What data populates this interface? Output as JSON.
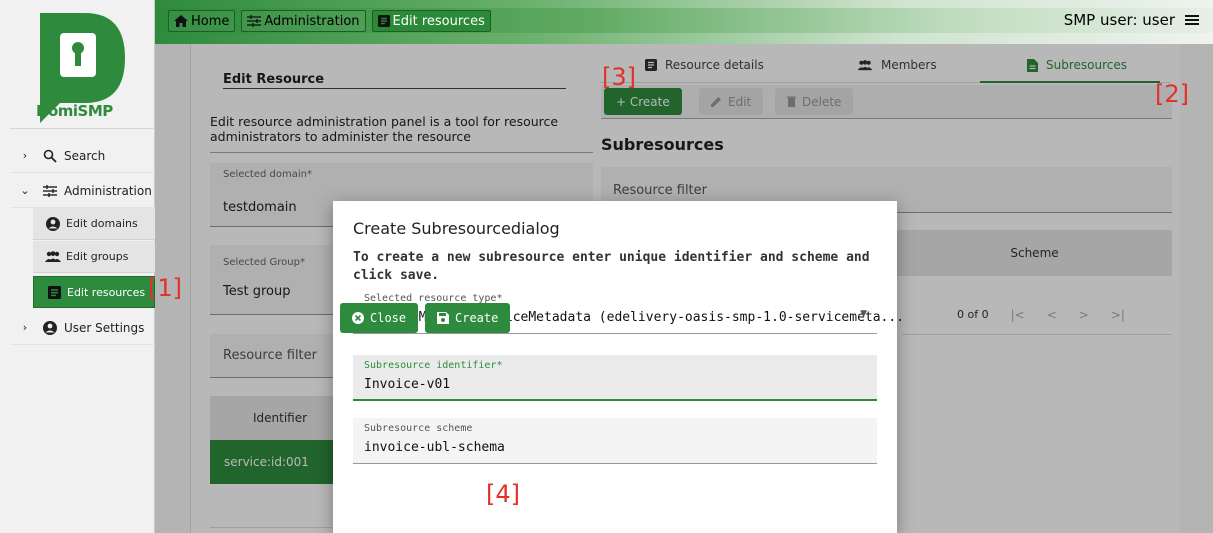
{
  "header": {
    "breadcrumbs": [
      "Home",
      "Administration",
      "Edit resources"
    ],
    "user_label": "SMP user: user"
  },
  "sidebar": {
    "logo_text": "DomiSMP",
    "items": [
      {
        "label": "Search"
      },
      {
        "label": "Administration"
      },
      {
        "label": "Edit domains"
      },
      {
        "label": "Edit groups"
      },
      {
        "label": "Edit resources"
      },
      {
        "label": "User Settings"
      }
    ]
  },
  "left_panel": {
    "title": "Edit Resource",
    "description": "Edit resource administration panel is a tool for resource administrators to administer the resource",
    "domain_label": "Selected domain*",
    "domain_value": "testdomain",
    "group_label": "Selected Group*",
    "group_value": "Test group",
    "filter_placeholder": "Resource filter",
    "table_header": "Identifier",
    "selected_row": "service:id:001"
  },
  "right_panel": {
    "tabs": [
      "Resource details",
      "Members",
      "Subresources"
    ],
    "toolbar": {
      "create": "+ Create",
      "edit": "Edit",
      "delete": "Delete"
    },
    "section_title": "Subresources",
    "filter_placeholder": "Resource filter",
    "table_header": "Scheme",
    "pager_text": "0 of 0"
  },
  "annotations": [
    "[1]",
    "[2]",
    "[3]",
    "[4]"
  ],
  "dialog": {
    "title": "Create Subresourcedialog",
    "subtitle": "To create a new subresource enter unique identifier and scheme and click save.",
    "resource_type_label": "Selected resource type*",
    "resource_type_value": "Oasis SMP 1.0 ServiceMetadata (edelivery-oasis-smp-1.0-servicemeta...",
    "identifier_label": "Subresource identifier*",
    "identifier_value": "Invoice-v01",
    "scheme_label": "Subresource scheme",
    "scheme_value": "invoice-ubl-schema",
    "close_label": "Close",
    "create_label": "Create"
  },
  "colors": {
    "accent": "#2e8b3d",
    "annotation": "#e0312a"
  }
}
